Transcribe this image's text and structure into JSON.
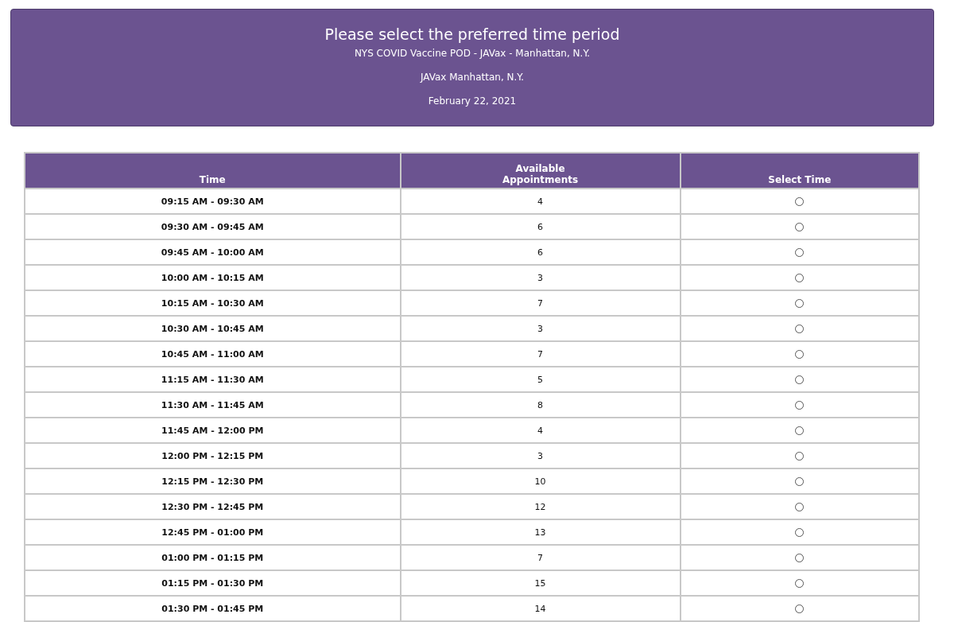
{
  "header": {
    "title": "Please select the preferred time period",
    "lines": [
      "NYS COVID Vaccine POD - JAVax - Manhattan, N.Y.",
      "JAVax Manhattan, N.Y.",
      "February 22, 2021"
    ]
  },
  "table": {
    "columns": [
      "Time",
      "Available Appointments",
      "Select Time"
    ],
    "rows": [
      {
        "time": "09:15 AM - 09:30 AM",
        "available": "4",
        "selected": false
      },
      {
        "time": "09:30 AM - 09:45 AM",
        "available": "6",
        "selected": false
      },
      {
        "time": "09:45 AM - 10:00 AM",
        "available": "6",
        "selected": false
      },
      {
        "time": "10:00 AM - 10:15 AM",
        "available": "3",
        "selected": false
      },
      {
        "time": "10:15 AM - 10:30 AM",
        "available": "7",
        "selected": false
      },
      {
        "time": "10:30 AM - 10:45 AM",
        "available": "3",
        "selected": false
      },
      {
        "time": "10:45 AM - 11:00 AM",
        "available": "7",
        "selected": false
      },
      {
        "time": "11:15 AM - 11:30 AM",
        "available": "5",
        "selected": false
      },
      {
        "time": "11:30 AM - 11:45 AM",
        "available": "8",
        "selected": false
      },
      {
        "time": "11:45 AM - 12:00 PM",
        "available": "4",
        "selected": false
      },
      {
        "time": "12:00 PM - 12:15 PM",
        "available": "3",
        "selected": false
      },
      {
        "time": "12:15 PM - 12:30 PM",
        "available": "10",
        "selected": false
      },
      {
        "time": "12:30 PM - 12:45 PM",
        "available": "12",
        "selected": false
      },
      {
        "time": "12:45 PM - 01:00 PM",
        "available": "13",
        "selected": false
      },
      {
        "time": "01:00 PM - 01:15 PM",
        "available": "7",
        "selected": false
      },
      {
        "time": "01:15 PM - 01:30 PM",
        "available": "15",
        "selected": false
      },
      {
        "time": "01:30 PM - 01:45 PM",
        "available": "14",
        "selected": false
      }
    ]
  }
}
